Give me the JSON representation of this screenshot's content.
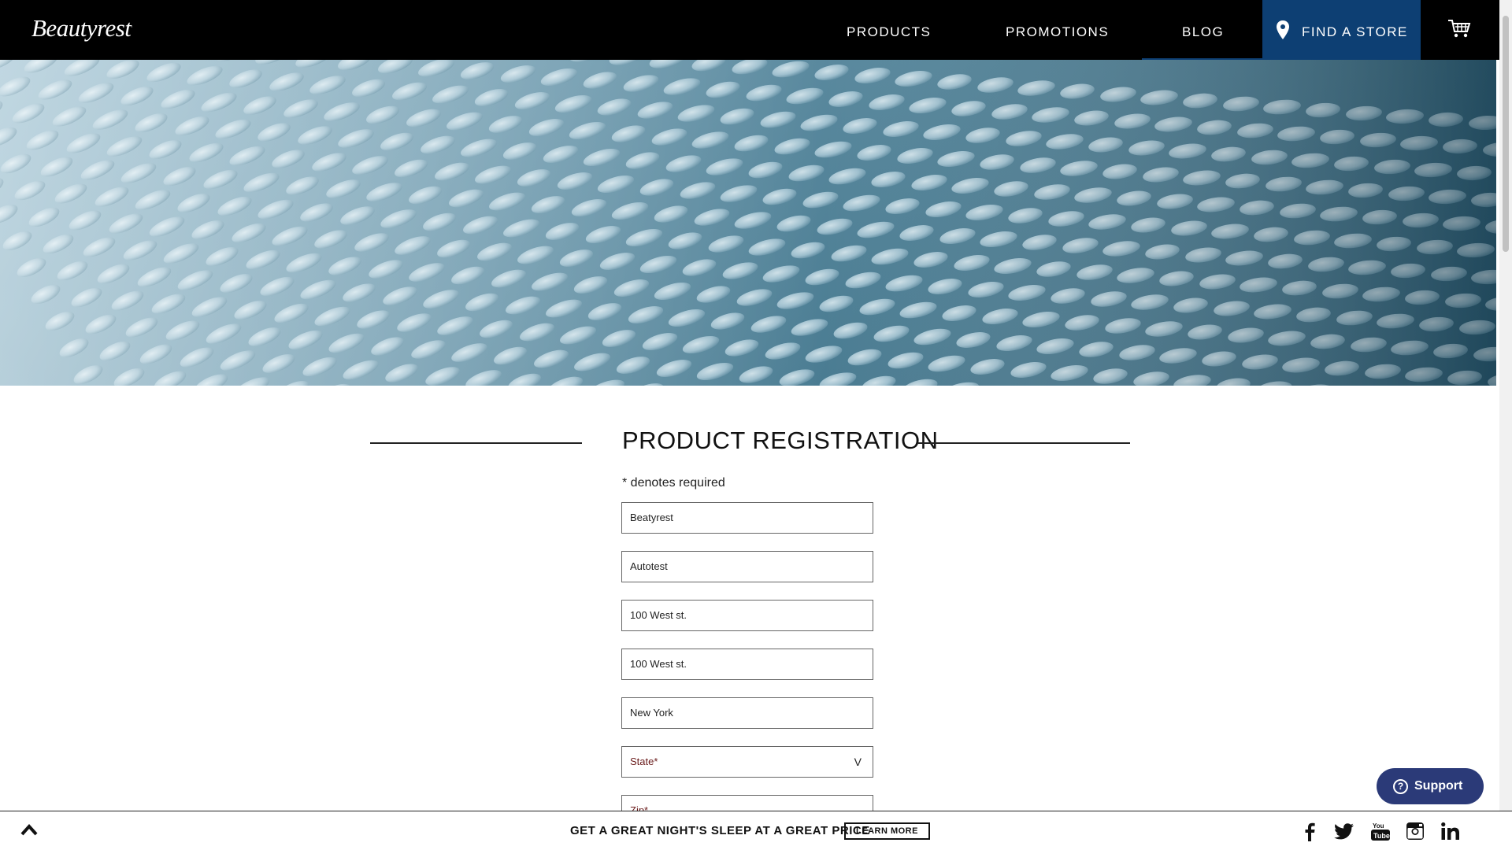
{
  "header": {
    "logo": "Beautyrest",
    "nav": {
      "products": "PRODUCTS",
      "promotions": "PROMOTIONS",
      "blog": "BLOG",
      "find_store": "FIND A STORE"
    }
  },
  "form": {
    "title": "PRODUCT REGISTRATION",
    "required_note": "* denotes required",
    "fields": {
      "first_name": "Beatyrest",
      "last_name": "Autotest",
      "address1": "100 West st.",
      "address2": "100 West st.",
      "city": "New York",
      "state_placeholder": "State*",
      "zip_placeholder": "Zip*"
    }
  },
  "support": {
    "label": "Support"
  },
  "footer": {
    "promo": "GET A GREAT NIGHT'S SLEEP AT A GREAT PRICE",
    "learn_more": "LEARN MORE"
  },
  "icons": {
    "pin": "map-pin-icon",
    "cart": "shopping-cart-icon",
    "up": "arrow-up-icon",
    "help": "question-icon",
    "facebook": "facebook-icon",
    "twitter": "twitter-icon",
    "youtube": "youtube-icon",
    "instagram": "instagram-icon",
    "linkedin": "linkedin-icon"
  },
  "colors": {
    "header_bg": "#000000",
    "find_store_bg": "#0d3f73",
    "support_bg": "#2b3a78"
  }
}
